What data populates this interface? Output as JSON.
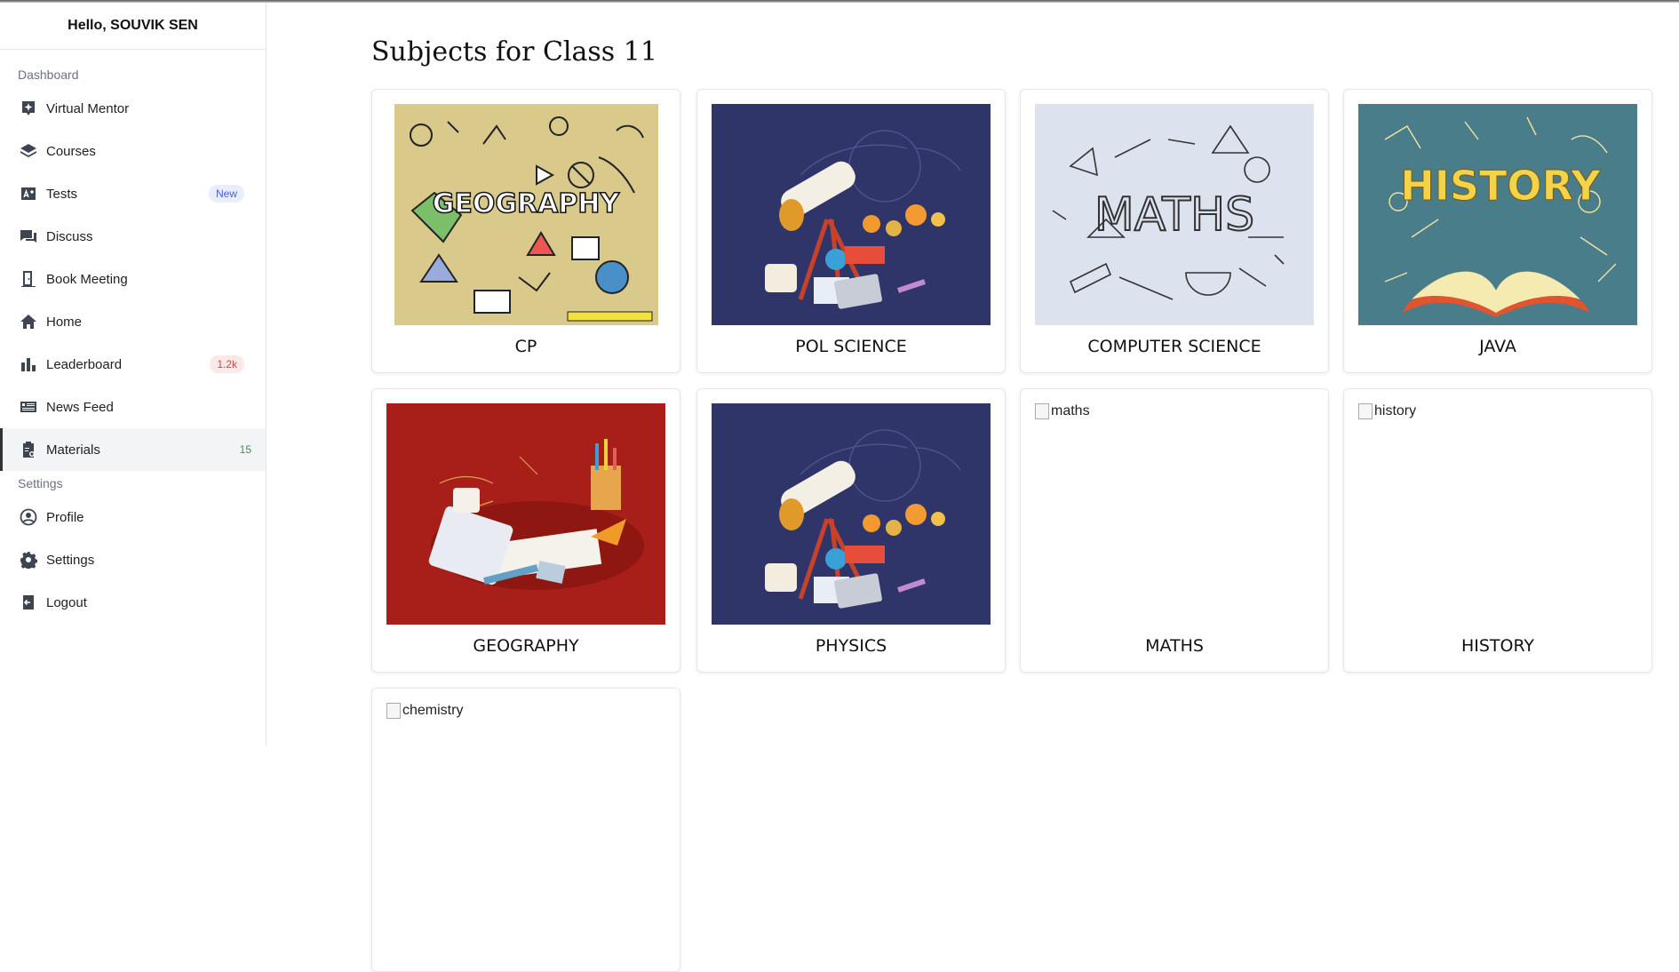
{
  "sidebar": {
    "greeting": "Hello, SOUVIK SEN",
    "section_dashboard": "Dashboard",
    "section_settings": "Settings",
    "items": [
      {
        "label": "Virtual Mentor",
        "icon": "sparkle-icon"
      },
      {
        "label": "Courses",
        "icon": "layers-icon"
      },
      {
        "label": "Tests",
        "icon": "test-icon",
        "badge": "New"
      },
      {
        "label": "Discuss",
        "icon": "chat-icon"
      },
      {
        "label": "Book Meeting",
        "icon": "door-icon"
      },
      {
        "label": "Home",
        "icon": "home-icon"
      },
      {
        "label": "Leaderboard",
        "icon": "bar-chart-icon",
        "badge": "1.2k"
      },
      {
        "label": "News Feed",
        "icon": "newspaper-icon"
      },
      {
        "label": "Materials",
        "icon": "clipboard-icon",
        "badge": "15",
        "active": true
      }
    ],
    "settings_items": [
      {
        "label": "Profile",
        "icon": "user-circle-icon"
      },
      {
        "label": "Settings",
        "icon": "gear-icon"
      },
      {
        "label": "Logout",
        "icon": "logout-icon"
      }
    ]
  },
  "main": {
    "title": "Subjects for Class 11",
    "subjects": [
      {
        "label": "CP",
        "image": "GEOGRAPHY",
        "image_kind": "geography-doodle"
      },
      {
        "label": "POL SCIENCE",
        "image_kind": "science-telescope"
      },
      {
        "label": "COMPUTER SCIENCE",
        "image": "MATHS",
        "image_kind": "maths-sketch"
      },
      {
        "label": "JAVA",
        "image": "HISTORY",
        "image_kind": "history-book"
      },
      {
        "label": "GEOGRAPHY",
        "image_kind": "math-desk-red"
      },
      {
        "label": "PHYSICS",
        "image_kind": "science-telescope"
      },
      {
        "label": "MATHS",
        "alt": "maths"
      },
      {
        "label": "HISTORY",
        "alt": "history"
      },
      {
        "label": "",
        "alt": "chemistry"
      }
    ]
  },
  "colors": {
    "accent_active": "#333333",
    "badge_new": "#4a5fd6",
    "badge_red": "#d64545",
    "badge_green": "#22a34a"
  }
}
